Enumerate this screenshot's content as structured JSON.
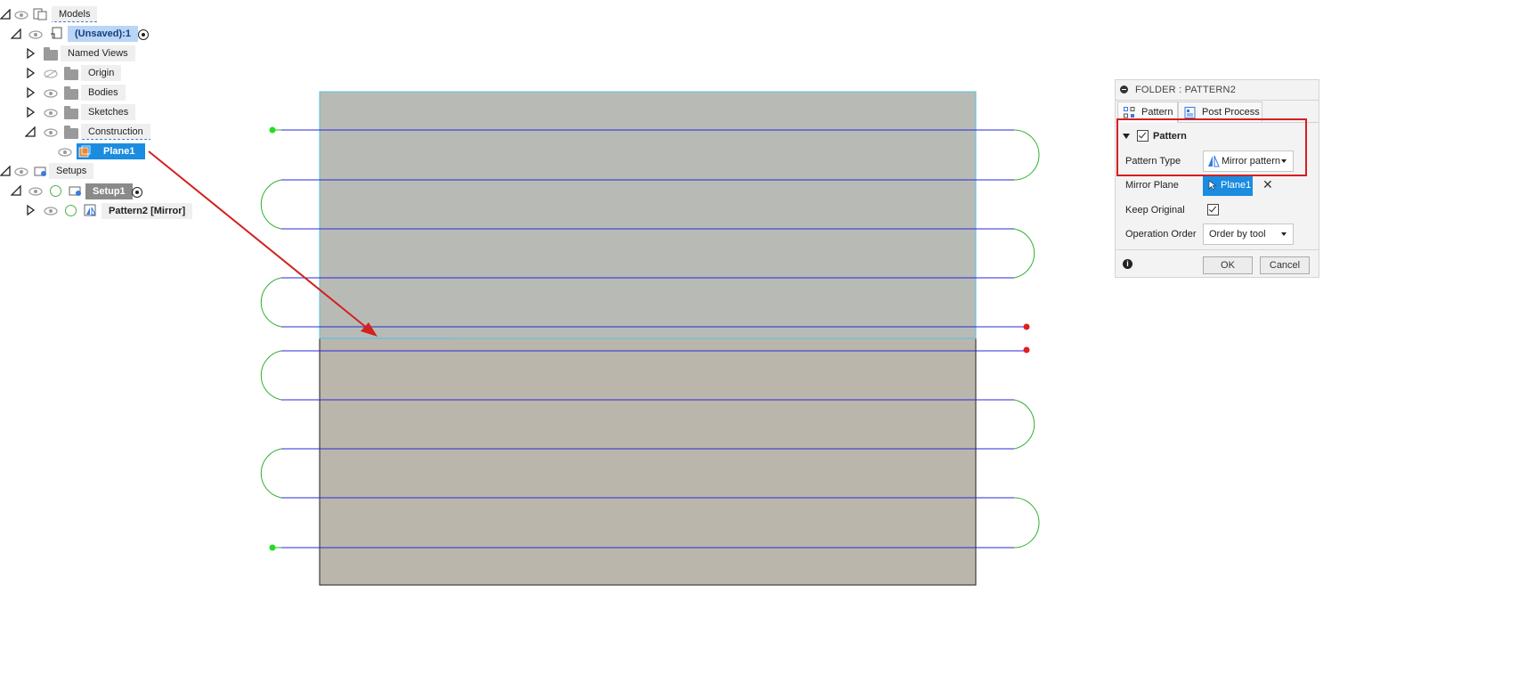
{
  "tree": {
    "models": "Models",
    "document": "(Unsaved):1",
    "named_views": "Named Views",
    "origin": "Origin",
    "bodies": "Bodies",
    "sketches": "Sketches",
    "construction": "Construction",
    "plane": "Plane1",
    "setups": "Setups",
    "setup": "Setup1",
    "pattern": "Pattern2 [Mirror]"
  },
  "dialog": {
    "title": "FOLDER : PATTERN2",
    "tabs": [
      "Pattern",
      "Post Process"
    ],
    "section": "Pattern",
    "section_checked": true,
    "pattern_type_label": "Pattern Type",
    "pattern_type_value": "Mirror pattern",
    "mirror_plane_label": "Mirror Plane",
    "mirror_plane_value": "Plane1",
    "keep_original_label": "Keep Original",
    "keep_original_checked": true,
    "operation_order_label": "Operation Order",
    "operation_order_value": "Order by tool",
    "ok": "OK",
    "cancel": "Cancel"
  },
  "colors": {
    "selection": "#1b8ce0",
    "highlight_box": "#d32020",
    "arrow": "#d32020",
    "toolpath_cut": "#2a2ad8",
    "toolpath_link": "#2fb02f"
  },
  "icons": {
    "expand": "triangle-right-icon",
    "collapse": "triangle-down-icon",
    "visibility": "eye-icon",
    "hidden": "eye-slash-icon",
    "folder": "folder-icon",
    "activate": "radio-dot-icon",
    "ok_status": "check-circle-icon",
    "info": "info-icon",
    "close": "close-icon"
  }
}
